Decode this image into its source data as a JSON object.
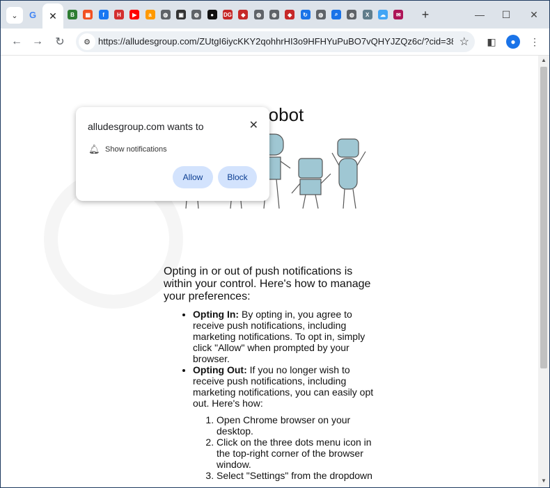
{
  "browser": {
    "active_tab_close": "✕",
    "new_tab": "+",
    "url": "https://alludesgroup.com/ZUtgI6iycKKY2qohhrHI3o9HFHYuPuBO7vQHYJZQz6c/?cid=380b78...",
    "tab_favicons": [
      {
        "icon": "grocery-icon",
        "color": "#2e7d32",
        "glyph": "B"
      },
      {
        "icon": "microsoft-icon",
        "color": "#f25022",
        "glyph": "▦"
      },
      {
        "icon": "facebook-icon",
        "color": "#1877f2",
        "glyph": "f"
      },
      {
        "icon": "h-icon",
        "color": "#d32f2f",
        "glyph": "H"
      },
      {
        "icon": "youtube-icon",
        "color": "#ff0000",
        "glyph": "▶"
      },
      {
        "icon": "amazon-icon",
        "color": "#ff9900",
        "glyph": "a"
      },
      {
        "icon": "globe-icon",
        "color": "#5f6368",
        "glyph": "◍"
      },
      {
        "icon": "app-icon",
        "color": "#333333",
        "glyph": "▣"
      },
      {
        "icon": "globe-icon",
        "color": "#5f6368",
        "glyph": "◍"
      },
      {
        "icon": "dark-circle-icon",
        "color": "#111111",
        "glyph": "●"
      },
      {
        "icon": "dg-icon",
        "color": "#c62828",
        "glyph": "DG"
      },
      {
        "icon": "map-icon",
        "color": "#c62828",
        "glyph": "◆"
      },
      {
        "icon": "globe-icon",
        "color": "#5f6368",
        "glyph": "◍"
      },
      {
        "icon": "globe-icon",
        "color": "#5f6368",
        "glyph": "◍"
      },
      {
        "icon": "map-icon",
        "color": "#c62828",
        "glyph": "◆"
      },
      {
        "icon": "refresh-icon",
        "color": "#1a73e8",
        "glyph": "↻"
      },
      {
        "icon": "globe-icon",
        "color": "#5f6368",
        "glyph": "◍"
      },
      {
        "icon": "search-icon",
        "color": "#1a73e8",
        "glyph": "⌕"
      },
      {
        "icon": "globe-icon",
        "color": "#5f6368",
        "glyph": "◍"
      },
      {
        "icon": "xcel-icon",
        "color": "#607d8b",
        "glyph": "X"
      },
      {
        "icon": "cloud-icon",
        "color": "#42a5f5",
        "glyph": "☁"
      },
      {
        "icon": "mail-icon",
        "color": "#ad1457",
        "glyph": "✉"
      }
    ]
  },
  "popup": {
    "title": "alludesgroup.com wants to",
    "permission": "Show notifications",
    "allow": "Allow",
    "block": "Block"
  },
  "page": {
    "heading": "ou are not   a robot",
    "intro": "Opting in or out of push notifications is within your control. Here's how to manage your preferences:",
    "list": [
      {
        "label": "Opting In:",
        "text": " By opting in, you agree to receive push notifications, including marketing notifications. To opt in, simply click \"Allow\" when prompted by your browser."
      },
      {
        "label": "Opting Out:",
        "text": " If you no longer wish to receive push notifications, including marketing notifications, you can easily opt out. Here's how:"
      }
    ],
    "steps": [
      "Open Chrome browser on your desktop.",
      "Click on the three dots menu icon in the top-right corner of the browser window.",
      "Select \"Settings\" from the dropdown"
    ]
  }
}
